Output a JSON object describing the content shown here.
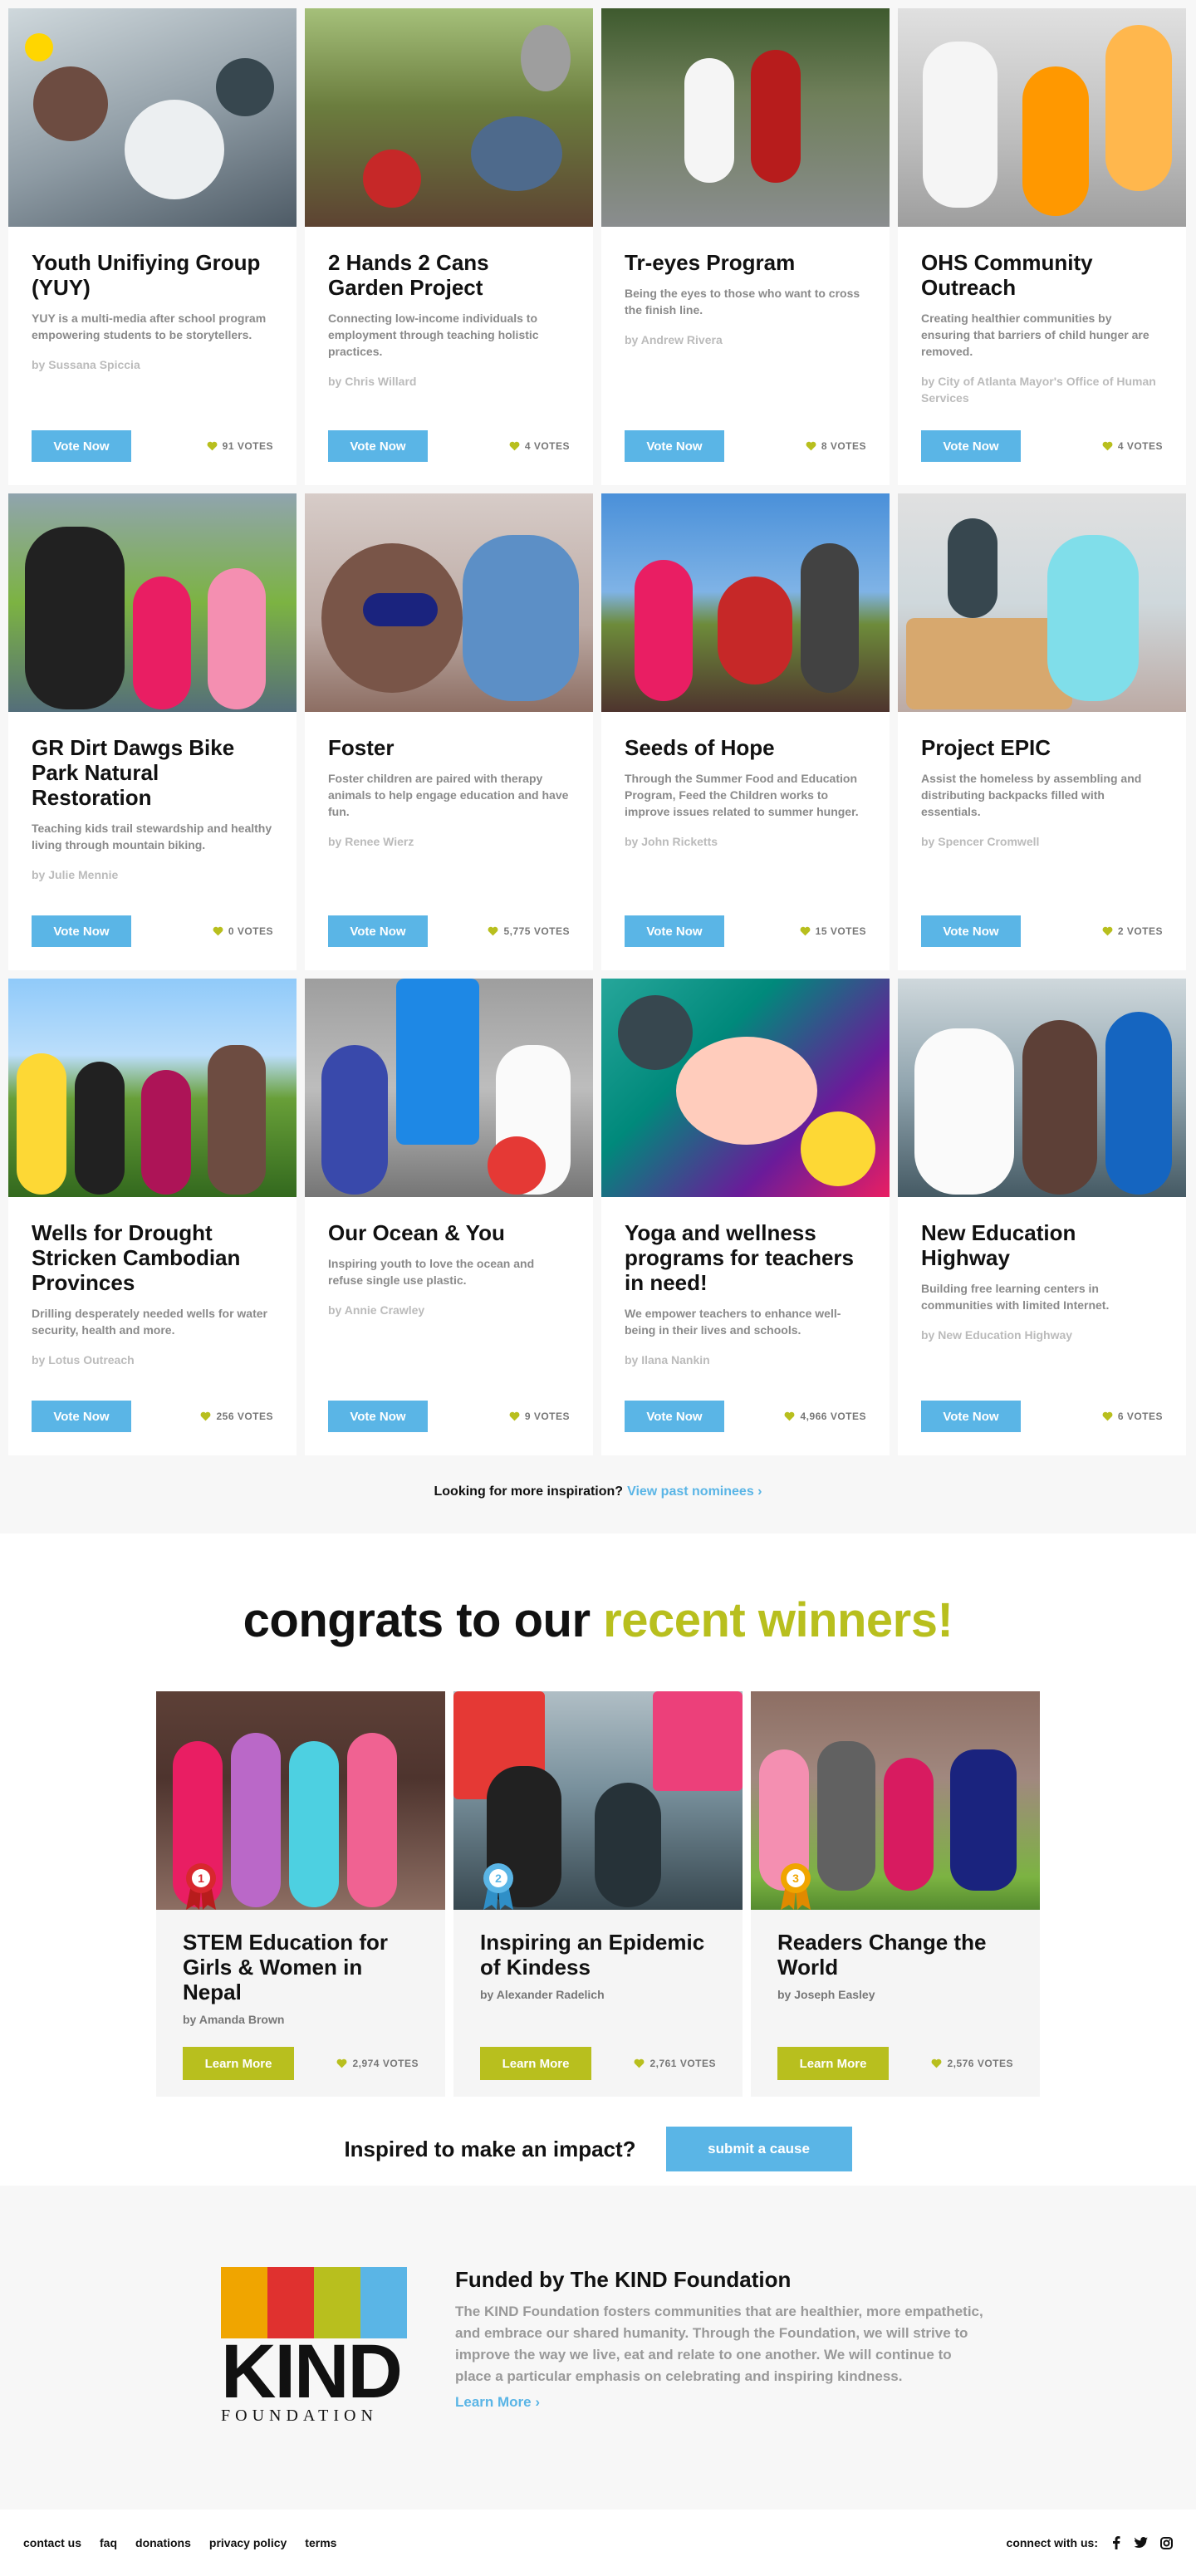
{
  "nominees": {
    "vote_label": "Vote Now",
    "accent_color": "#5ab5e6",
    "heart_color": "#b8bf1e",
    "cards": [
      {
        "title": "Youth Unifiying Group (YUY)",
        "desc": "YUY is a multi-media after school program empowering students to be storytellers.",
        "author": "by Sussana Spiccia",
        "votes": "91 VOTES"
      },
      {
        "title": "2 Hands 2 Cans Garden Project",
        "desc": "Connecting low-income individuals to employment through teaching holistic practices.",
        "author": "by Chris Willard",
        "votes": "4 VOTES"
      },
      {
        "title": "Tr-eyes Program",
        "desc": "Being the eyes to those who want to cross the finish line.",
        "author": "by Andrew Rivera",
        "votes": "8 VOTES"
      },
      {
        "title": "OHS Community Outreach",
        "desc": "Creating healthier communities by ensuring that barriers of child hunger are removed.",
        "author": "by City of Atlanta Mayor's Office of Human Services",
        "votes": "4 VOTES"
      },
      {
        "title": "GR Dirt Dawgs Bike Park Natural Restoration",
        "desc": "Teaching kids trail stewardship and healthy living through mountain biking.",
        "author": "by Julie Mennie",
        "votes": "0 VOTES"
      },
      {
        "title": "Foster",
        "desc": "Foster children are paired with therapy animals to help engage education and have fun.",
        "author": "by Renee Wierz",
        "votes": "5,775 VOTES"
      },
      {
        "title": "Seeds of Hope",
        "desc": "Through the Summer Food and Education Program, Feed the Children works to improve issues related to summer hunger.",
        "author": "by John Ricketts",
        "votes": "15 VOTES"
      },
      {
        "title": "Project EPIC",
        "desc": "Assist the homeless by assembling and distributing backpacks filled with essentials.",
        "author": "by Spencer Cromwell",
        "votes": "2 VOTES"
      },
      {
        "title": "Wells for Drought Stricken Cambodian Provinces",
        "desc": "Drilling desperately needed wells for water security, health and more.",
        "author": "by Lotus Outreach",
        "votes": "256 VOTES"
      },
      {
        "title": "Our Ocean & You",
        "desc": "Inspiring youth to love the ocean and refuse single use plastic.",
        "author": "by Annie Crawley",
        "votes": "9 VOTES"
      },
      {
        "title": "Yoga and wellness programs for teachers in need!",
        "desc": "We empower teachers to enhance well-being in their lives and schools.",
        "author": "by Ilana Nankin",
        "votes": "4,966 VOTES"
      },
      {
        "title": "New Education Highway",
        "desc": "Building free learning centers in communities with limited Internet.",
        "author": "by New Education Highway",
        "votes": "6 VOTES"
      }
    ]
  },
  "inspiration": {
    "text": "Looking for more inspiration?",
    "link": "View past nominees ›"
  },
  "winners": {
    "heading_plain": "congrats to our",
    "heading_accent": "recent winners!",
    "learn_label": "Learn More",
    "items": [
      {
        "rank": "1",
        "title": "STEM Education for Girls & Women in Nepal",
        "author": "by Amanda Brown",
        "votes": "2,974 VOTES",
        "ribbon_color": "#d8272e"
      },
      {
        "rank": "2",
        "title": "Inspiring an Epidemic of Kindess",
        "author": "by Alexander Radelich",
        "votes": "2,761 VOTES",
        "ribbon_color": "#5ab5e6"
      },
      {
        "rank": "3",
        "title": "Readers Change the World",
        "author": "by Joseph Easley",
        "votes": "2,576 VOTES",
        "ribbon_color": "#f0a500"
      }
    ]
  },
  "impact": {
    "text": "Inspired to make an impact?",
    "button": "submit a cause"
  },
  "foundation": {
    "logo_word": "KIND",
    "logo_sub": "FOUNDATION",
    "logo_colors": [
      "#f0a500",
      "#e0312f",
      "#b8bf1e",
      "#5ab5e6"
    ],
    "title": "Funded by The KIND Foundation",
    "desc": "The KIND Foundation fosters communities that are healthier, more empathetic, and embrace our shared humanity. Through the Foundation, we will strive to improve the way we live, eat and relate to one another. We will continue to place a particular emphasis on celebrating and inspiring kindness.",
    "link": "Learn More ›"
  },
  "footer": {
    "links": [
      "contact us",
      "faq",
      "donations",
      "privacy policy",
      "terms"
    ],
    "connect": "connect with us:",
    "social_icons": [
      "facebook-icon",
      "twitter-icon",
      "instagram-icon"
    ]
  }
}
